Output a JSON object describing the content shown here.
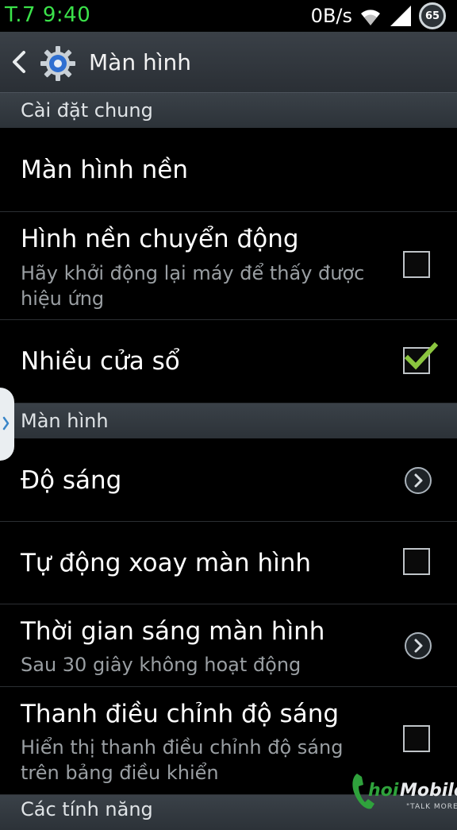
{
  "status_bar": {
    "time": "T.7 9:40",
    "net_speed": "0B/s",
    "battery": "65",
    "icons": [
      "wifi-icon",
      "signal-icon",
      "battery-icon"
    ]
  },
  "action_bar": {
    "title": "Màn hình",
    "icons": [
      "back-icon",
      "settings-gear-icon"
    ]
  },
  "sections": [
    {
      "header": "Cài đặt chung",
      "items": [
        {
          "title": "Màn hình nền"
        },
        {
          "title": "Hình nền chuyển động",
          "subtitle": "Hãy khởi động lại máy để thấy được hiệu ứng",
          "checked": false
        },
        {
          "title": "Nhiều cửa sổ",
          "checked": true
        }
      ]
    },
    {
      "header": "Màn hình",
      "items": [
        {
          "title": "Độ sáng",
          "control": "chevron"
        },
        {
          "title": "Tự động xoay màn hình",
          "checked": false
        },
        {
          "title": "Thời gian sáng màn hình",
          "subtitle": "Sau 30 giây không hoạt động",
          "control": "chevron"
        },
        {
          "title": "Thanh điều chỉnh độ sáng",
          "subtitle": "Hiển thị thanh điều chỉnh độ sáng trên bảng điều khiển",
          "checked": false
        }
      ]
    },
    {
      "header": "Các tính năng"
    }
  ],
  "watermark": {
    "brand": "ChoiMobile",
    "tagline": "TALK MORE"
  },
  "colors": {
    "accent_check": "#8bc53f",
    "time_green": "#3be24a",
    "action_bar": "#33393f"
  }
}
